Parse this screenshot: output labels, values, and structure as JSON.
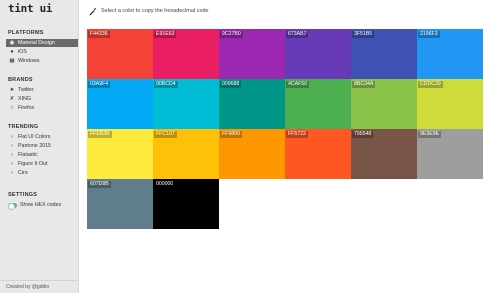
{
  "app": {
    "logo": "tint ui"
  },
  "topbar": {
    "hint": "Select a color to copy the hexadecimal code"
  },
  "sidebar": {
    "sections": [
      {
        "title": "PLATFORMS",
        "items": [
          {
            "label": "Material Design",
            "icon": "material-design-icon",
            "active": true
          },
          {
            "label": "iOS",
            "icon": "apple-icon",
            "active": false
          },
          {
            "label": "Windows",
            "icon": "windows-icon",
            "active": false
          }
        ]
      },
      {
        "title": "BRANDS",
        "items": [
          {
            "label": "Twitter",
            "icon": "twitter-icon",
            "active": false
          },
          {
            "label": "XING",
            "icon": "xing-icon",
            "active": false
          },
          {
            "label": "Firefox",
            "icon": "firefox-icon",
            "active": false
          }
        ]
      },
      {
        "title": "TRENDING",
        "items": [
          {
            "label": "Flat UI Colors",
            "icon": "chevron-right-icon",
            "active": false
          },
          {
            "label": "Pantone 2015",
            "icon": "chevron-right-icon",
            "active": false
          },
          {
            "label": "Flatastic",
            "icon": "chevron-right-icon",
            "active": false
          },
          {
            "label": "Figure It Out",
            "icon": "chevron-right-icon",
            "active": false
          },
          {
            "label": "Ciro",
            "icon": "chevron-right-icon",
            "active": false
          }
        ]
      },
      {
        "title": "SETTINGS",
        "items": [
          {
            "label": "Show HEX codes",
            "icon": "toggle-on-icon",
            "active": false
          }
        ]
      }
    ],
    "footer": "Created by @gddio"
  },
  "swatches": [
    {
      "hex": "F44336",
      "color": "#F44336"
    },
    {
      "hex": "E91E63",
      "color": "#E91E63"
    },
    {
      "hex": "9C27B0",
      "color": "#9C27B0"
    },
    {
      "hex": "673AB7",
      "color": "#673AB7"
    },
    {
      "hex": "3F51B5",
      "color": "#3F51B5"
    },
    {
      "hex": "2196F3",
      "color": "#2196F3"
    },
    {
      "hex": "03A9F4",
      "color": "#03A9F4"
    },
    {
      "hex": "00BCD4",
      "color": "#00BCD4"
    },
    {
      "hex": "009688",
      "color": "#009688"
    },
    {
      "hex": "4CAF50",
      "color": "#4CAF50"
    },
    {
      "hex": "8BC34A",
      "color": "#8BC34A"
    },
    {
      "hex": "CDDC39",
      "color": "#CDDC39"
    },
    {
      "hex": "FFEB3B",
      "color": "#FFEB3B"
    },
    {
      "hex": "FFC107",
      "color": "#FFC107"
    },
    {
      "hex": "FF9800",
      "color": "#FF9800"
    },
    {
      "hex": "FF5722",
      "color": "#FF5722"
    },
    {
      "hex": "795548",
      "color": "#795548"
    },
    {
      "hex": "9E9E9E",
      "color": "#9E9E9E"
    },
    {
      "hex": "607D8B",
      "color": "#607D8B"
    },
    {
      "hex": "000000",
      "color": "#000000"
    }
  ]
}
